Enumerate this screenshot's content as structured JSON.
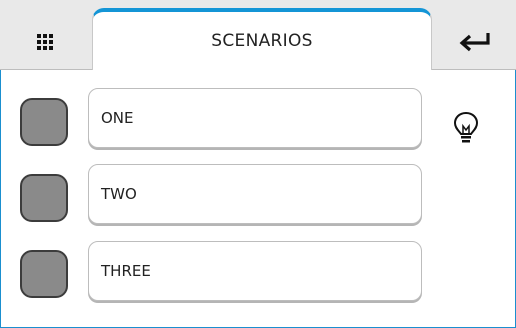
{
  "header": {
    "title": "SCENARIOS",
    "menu_icon": "grid-icon",
    "back_icon": "return-arrow-icon",
    "accent_color": "#1495d6"
  },
  "scenarios": [
    {
      "label": "ONE",
      "indicator_icon": "lightbulb-icon"
    },
    {
      "label": "TWO"
    },
    {
      "label": "THREE"
    }
  ]
}
